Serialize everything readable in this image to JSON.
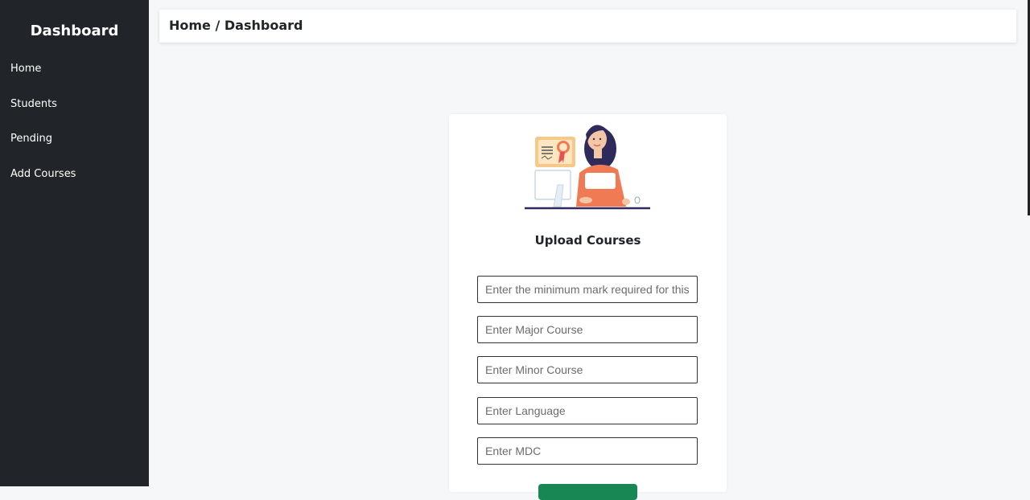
{
  "sidebar": {
    "title": "Dashboard",
    "items": [
      {
        "label": "Home"
      },
      {
        "label": "Students"
      },
      {
        "label": "Pending"
      },
      {
        "label": "Add Courses"
      }
    ]
  },
  "header": {
    "breadcrumb": "Home / Dashboard"
  },
  "form": {
    "title": "Upload Courses",
    "fields": [
      {
        "placeholder": "Enter the minimum mark required for this",
        "value": ""
      },
      {
        "placeholder": "Enter Major Course",
        "value": ""
      },
      {
        "placeholder": "Enter Minor Course",
        "value": ""
      },
      {
        "placeholder": "Enter Language",
        "value": ""
      },
      {
        "placeholder": "Enter MDC",
        "value": ""
      }
    ],
    "submit_color": "#198754"
  },
  "colors": {
    "sidebar_bg": "#212529",
    "page_bg": "#f6f7f9",
    "accent": "#f07a53"
  }
}
